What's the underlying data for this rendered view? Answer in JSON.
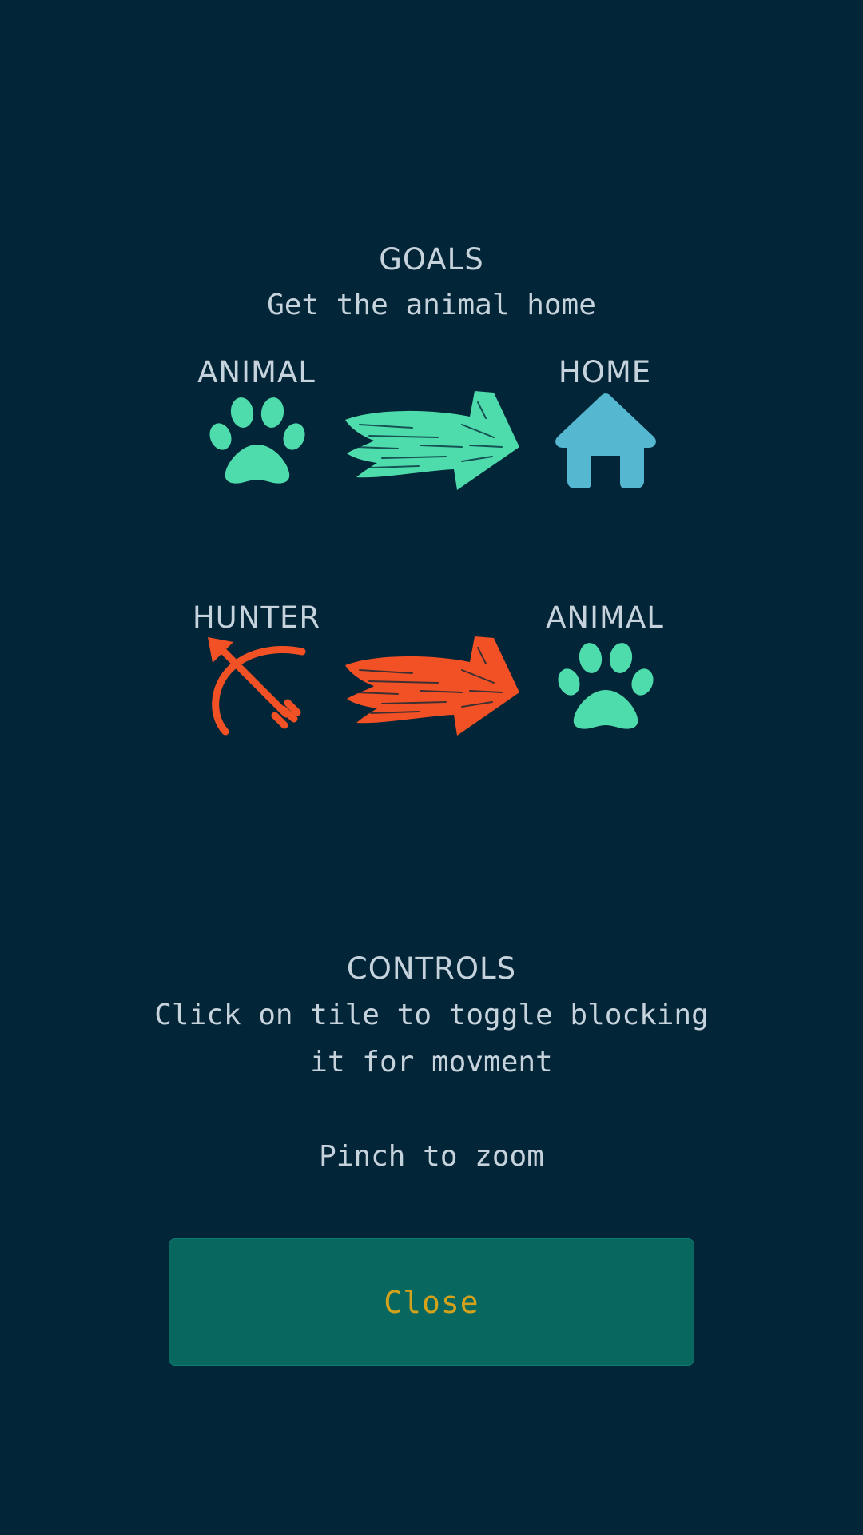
{
  "goals": {
    "heading": "GOALS",
    "description": "Get the animal home",
    "left_label": "ANIMAL",
    "right_label": "HOME",
    "left_icon": "paw-icon",
    "arrow_icon": "arrow-right-icon",
    "right_icon": "house-icon"
  },
  "threat": {
    "left_label": "HUNTER",
    "right_label": "ANIMAL",
    "left_icon": "bow-and-arrow-icon",
    "arrow_icon": "arrow-right-icon",
    "right_icon": "paw-icon"
  },
  "controls": {
    "heading": "CONTROLS",
    "line1": "Click on tile to toggle blocking",
    "line2": "it for movment",
    "line3": "Pinch to zoom"
  },
  "close_button": {
    "label": "Close"
  },
  "colors": {
    "background": "#022537",
    "text": "#c7d3dc",
    "animal_green": "#4fdcac",
    "home_blue": "#55b8d0",
    "hunter_red": "#f25126",
    "button_bg": "#086860",
    "button_text": "#d4a21a"
  }
}
